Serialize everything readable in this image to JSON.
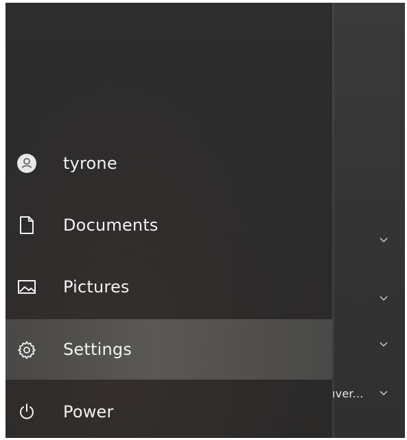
{
  "start_menu": {
    "items": [
      {
        "label": "tyrone",
        "icon": "user-avatar-icon"
      },
      {
        "label": "Documents",
        "icon": "document-icon"
      },
      {
        "label": "Pictures",
        "icon": "pictures-icon"
      },
      {
        "label": "Settings",
        "icon": "gear-icon",
        "selected": true
      },
      {
        "label": "Power",
        "icon": "power-icon"
      }
    ]
  },
  "right_panel": {
    "truncated_text": "ıver...",
    "chevron_count": 4
  },
  "colors": {
    "background": "#2c2b2b",
    "selected": "#565451",
    "text": "#f2f2f2"
  }
}
